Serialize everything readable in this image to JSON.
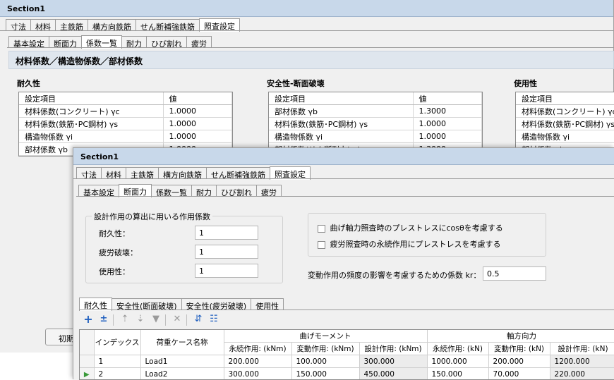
{
  "back": {
    "title": "Section1",
    "main_tabs": [
      "寸法",
      "材料",
      "主鉄筋",
      "横方向鉄筋",
      "せん断補強鉄筋",
      "照査設定"
    ],
    "sub_tabs": [
      "基本設定",
      "断面力",
      "係数一覧",
      "耐力",
      "ひび割れ",
      "疲労"
    ],
    "heading": "材料係数／構造物係数／部材係数",
    "left": {
      "title": "耐久性",
      "col1": "設定項目",
      "col2": "値",
      "rows": [
        {
          "k": "材料係数(コンクリート) γc",
          "v": "1.0000"
        },
        {
          "k": "材料係数(鉄筋･PC鋼材) γs",
          "v": "1.0000"
        },
        {
          "k": "構造物係数 γi",
          "v": "1.0000"
        },
        {
          "k": "部材係数 γb",
          "v": "1.0000"
        }
      ]
    },
    "mid": {
      "title": "安全性-断面破壊",
      "col1": "設定項目",
      "col2": "値",
      "rows": [
        {
          "k": "部材係数 γb",
          "v": "1.3000"
        },
        {
          "k": "材料係数(鉄筋･PC鋼材) γs",
          "v": "1.0000"
        },
        {
          "k": "構造物係数 γi",
          "v": "1.0000"
        },
        {
          "k": "部材係数(せん断耐力) γb",
          "v": "1.3000"
        }
      ]
    },
    "right": {
      "title": "使用性",
      "col1": "設定項目",
      "rows": [
        {
          "k": "材料係数(コンクリート) γc"
        },
        {
          "k": "材料係数(鉄筋･PC鋼材) γs"
        },
        {
          "k": "構造物係数 γi"
        },
        {
          "k": "部材係数 γb"
        }
      ]
    },
    "init_button": "初期"
  },
  "front": {
    "title": "Section1",
    "main_tabs": [
      "寸法",
      "材料",
      "主鉄筋",
      "横方向鉄筋",
      "せん断補強鉄筋",
      "照査設定"
    ],
    "sub_tabs": [
      "基本設定",
      "断面力",
      "係数一覧",
      "耐力",
      "ひび割れ",
      "疲労"
    ],
    "group_title": "設計作用の算出に用いる作用係数",
    "factors": [
      {
        "label": "耐久性：",
        "value": "1"
      },
      {
        "label": "疲労破壊：",
        "value": "1"
      },
      {
        "label": "使用性：",
        "value": "1"
      }
    ],
    "checks": [
      {
        "label": "曲げ軸力照査時のプレストレスにcosθを考慮する",
        "checked": false
      },
      {
        "label": "疲労照査時の永続作用にプレストレスを考慮する",
        "checked": false
      }
    ],
    "kr_label": "変動作用の頻度の影響を考慮するための係数 kr：",
    "kr_value": "0.5",
    "lower_tabs": [
      "耐久性",
      "安全性(断面破壊)",
      "安全性(疲労破壊)",
      "使用性"
    ],
    "toolbar_icons": [
      "add-icon",
      "insert-icon",
      "move-up-icon",
      "move-down-icon",
      "move-bottom-icon",
      "delete-icon",
      "expand-icon",
      "collapse-icon"
    ],
    "grid": {
      "col_index": "インデックス",
      "col_name": "荷重ケース名称",
      "group_moment": "曲げモーメント",
      "group_axial": "軸方向力",
      "sub_cols": [
        "永続作用: (kNm)",
        "変動作用: (kNm)",
        "設計作用: (kNm)",
        "永続作用: (kN)",
        "変動作用: (kN)",
        "設計作用: (kN)"
      ],
      "rows": [
        {
          "idx": "1",
          "name": "Load1",
          "c": [
            "200.000",
            "100.000",
            "300.000",
            "1000.000",
            "200.000",
            "1200.000"
          ]
        },
        {
          "idx": "2",
          "name": "Load2",
          "c": [
            "300.000",
            "150.000",
            "450.000",
            "150.000",
            "70.000",
            "220.000"
          ]
        }
      ]
    }
  },
  "colors": {
    "title_bar": "#c8d8ea",
    "row_arrow": "#3a9a3a",
    "icon_blue": "#1f5fbf"
  }
}
